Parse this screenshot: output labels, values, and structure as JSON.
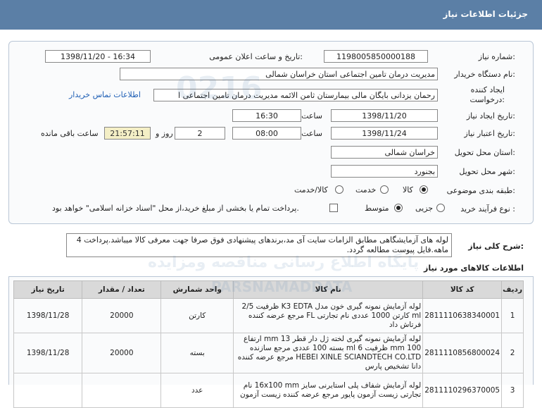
{
  "header": {
    "title": "جزئیات اطلاعات نیاز"
  },
  "form": {
    "need_number_label": "شماره نیاز:",
    "need_number": "1198005850000188",
    "announce_label": "تاریخ و ساعت اعلان عمومی:",
    "announce_value": "1398/11/20 - 16:34",
    "buyer_label": "نام دستگاه خریدار:",
    "buyer_value": "مدیریت درمان تامین اجتماعی استان خراسان شمالی",
    "creator_label_1": "ایجاد کننده",
    "creator_label_2": "درخواست:",
    "creator_value": "رحمان یزدانی بایگان مالی بیمارستان ثامن الائمه مدیریت درمان تامین اجتماعی ا",
    "contact_link": "اطلاعات تماس خریدار",
    "create_date_label": "تاریخ ایجاد نیاز:",
    "create_date": "1398/11/20",
    "time_label": "ساعت",
    "create_time": "16:30",
    "validity_label": "تاریخ اعتبار نیاز:",
    "validity_date": "1398/11/24",
    "validity_time": "08:00",
    "days_value": "2",
    "days_label": "روز و",
    "remaining_time": "21:57:11",
    "remaining_label": "ساعت باقی مانده",
    "province_label": "استان محل تحویل:",
    "province_value": "خراسان شمالی",
    "city_label": "شهر محل تحویل:",
    "city_value": "بجنورد",
    "category_label": "طبقه بندی موضوعی:",
    "category_options": [
      "کالا",
      "خدمت",
      "کالا/خدمت"
    ],
    "category_selected": "کالا",
    "process_label": "نوع فرآیند خرید :",
    "process_options": [
      "جزیی",
      "متوسط"
    ],
    "process_selected": "متوسط",
    "payment_note": "پرداخت تمام یا بخشی از مبلغ خرید،از محل \"اسناد خزانه اسلامی\" خواهد بود."
  },
  "description": {
    "label": "شرح کلی نیاز:",
    "text": "لوله های آزمایشگاهی مطابق الزامات سایت آی مد،برندهای پیشنهادی فوق صرفا جهت معرفی کالا میباشد.پرداخت 4 ماهه.فایل پیوست مطالعه گردد."
  },
  "items_section": {
    "title": "اطلاعات کالاهای مورد نیاز",
    "columns": [
      "ردیف",
      "کد کالا",
      "نام کالا",
      "واحد شمارش",
      "تعداد / مقدار",
      "تاریخ نیاز"
    ],
    "rows": [
      {
        "row": "1",
        "code": "2811110638340001",
        "name": "لوله آزمایش نمونه گیری خون مدل K3 EDTA ظرفیت 2/5 ml کارتن 1000 عددی نام تجارتی FL مرجع عرضه کننده فرتاش داد",
        "unit": "کارتن",
        "qty": "20000",
        "date": "1398/11/28"
      },
      {
        "row": "2",
        "code": "2811110856800024",
        "name": "لوله آزمایش نمونه گیری لخته ژل دار قطر 13 mm ارتفاع 100 mm ظرفیت 6 ml بسته 100 عددی مرجع سازنده HEBEI XINLE SCIANDTECH CO.LTD مرجع عرضه کننده دانا تشخیص پارس",
        "unit": "بسته",
        "qty": "20000",
        "date": "1398/11/28"
      },
      {
        "row": "3",
        "code": "2811110296370005",
        "name": "لوله آزمایش شفاف پلی استایرنی سایز 16x100 mm نام تجارتی زیست آزمون پایور مرجع عرضه کننده زیست آزمون",
        "unit": "عدد",
        "qty": "",
        "date": ""
      }
    ]
  },
  "watermark": {
    "line1": "پایگاه اطلاع رسانی مناقصه ومزایده",
    "line2": "PARSNAMADDATA",
    "line3": "0216"
  }
}
